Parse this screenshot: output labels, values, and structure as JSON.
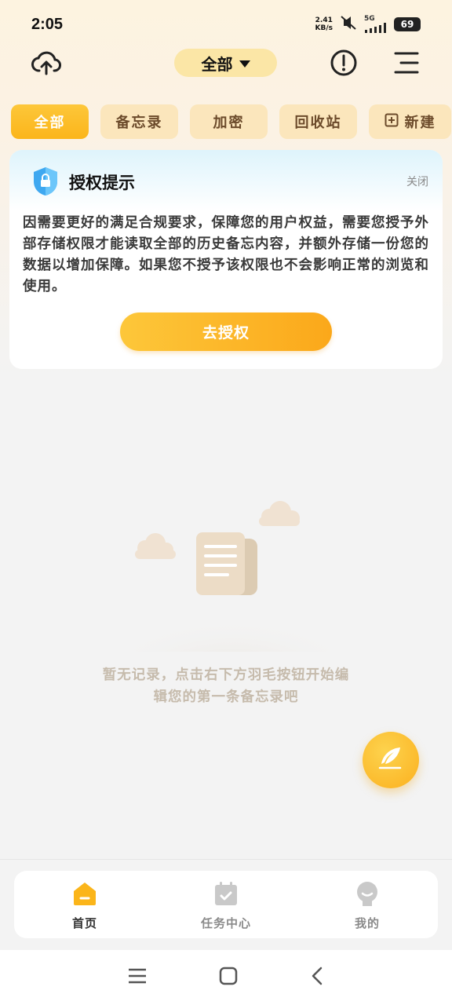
{
  "status_bar": {
    "time": "2:05",
    "net_speed_value": "2.41",
    "net_speed_unit": "KB/s",
    "network": "5G",
    "battery": "69",
    "icons": [
      "mute-icon",
      "signal-icon",
      "battery-icon"
    ]
  },
  "header": {
    "filter_label": "全部",
    "icons": [
      "cloud-upload-icon",
      "alert-icon",
      "menu-icon"
    ]
  },
  "tabs": [
    {
      "label": "全部",
      "active": true
    },
    {
      "label": "备忘录",
      "active": false
    },
    {
      "label": "加密",
      "active": false
    },
    {
      "label": "回收站",
      "active": false
    },
    {
      "label": "新建",
      "active": false,
      "icon": "add-note-icon"
    }
  ],
  "auth_card": {
    "title": "授权提示",
    "close_label": "关闭",
    "body": "因需要更好的满足合规要求，保障您的用户权益，需要您授予外部存储权限才能读取全部的历史备忘内容，并额外存储一份您的数据以增加保障。如果您不授予该权限也不会影响正常的浏览和使用。",
    "button_label": "去授权",
    "icon": "shield-lock-icon"
  },
  "empty_state": {
    "line1": "暂无记录，点击右下方羽毛按钮开始编",
    "line2": "辑您的第一条备忘录吧"
  },
  "fab": {
    "icon": "feather-icon"
  },
  "bottom_nav": [
    {
      "label": "首页",
      "icon": "home-icon",
      "active": true
    },
    {
      "label": "任务中心",
      "icon": "calendar-check-icon",
      "active": false
    },
    {
      "label": "我的",
      "icon": "profile-icon",
      "active": false
    }
  ],
  "colors": {
    "accent": "#fbb51a",
    "tab_bg": "#fbe6bc",
    "tab_text": "#6b4a2a",
    "empty_text": "#c6bbac"
  }
}
